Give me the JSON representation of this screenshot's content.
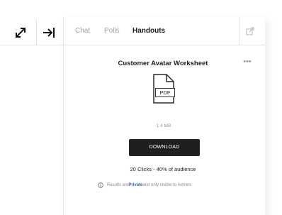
{
  "toolbar": {
    "expand_icon": "expand-arrows-icon",
    "collapse_icon": "collapse-to-right-icon"
  },
  "panel": {
    "tabs": [
      {
        "label": "Chat",
        "active": false
      },
      {
        "label": "Polls",
        "active": false
      },
      {
        "label": "Handouts",
        "active": true
      }
    ],
    "popout_icon": "popout-icon"
  },
  "handout": {
    "title": "Customer Avatar Worksheet",
    "more_label": "•••",
    "file_type": "PDF",
    "file_size": "1.4 MB",
    "download_label": "DOWNLOAD",
    "stats": "20 Clicks - 40% of audience",
    "privacy_prefix": "Results are ",
    "privacy_strong": "Private",
    "privacy_suffix": " and only visible to Admins"
  },
  "colors": {
    "button_bg": "#1f1f1f",
    "border": "#e2e2e2",
    "muted_text": "#a3a3a3"
  }
}
